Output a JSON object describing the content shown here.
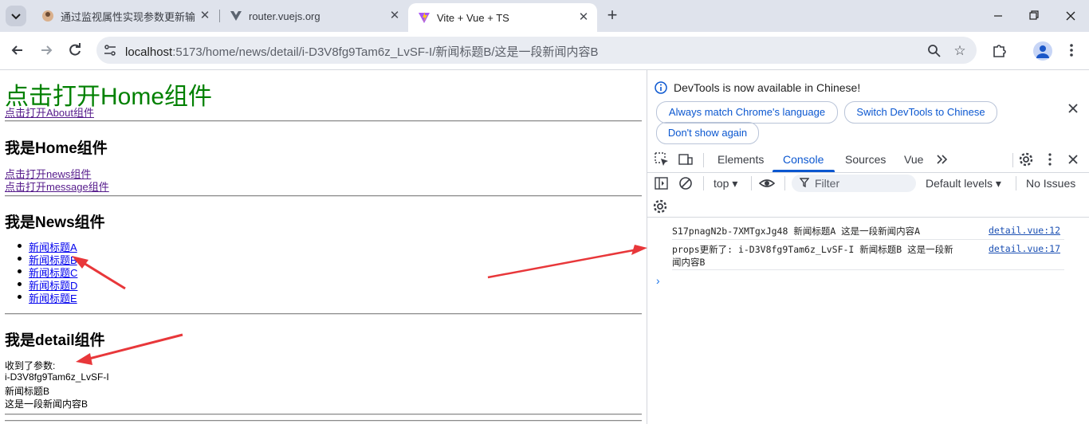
{
  "browser": {
    "tabs": [
      {
        "title": "通过监视属性实现参数更新输出",
        "icon": "vue-avatar-icon"
      },
      {
        "title": "router.vuejs.org",
        "icon": "vue-router-icon"
      },
      {
        "title": "Vite + Vue + TS",
        "icon": "vite-icon",
        "active": true
      }
    ],
    "url_host": "localhost",
    "url_path": ":5173/home/news/detail/i-D3V8fg9Tam6z_LvSF-I/新闻标题B/这是一段新闻内容B"
  },
  "page": {
    "title": "点击打开Home组件",
    "about_link": "点击打开About组件",
    "home_heading": "我是Home组件",
    "news_link": "点击打开news组件",
    "message_link": "点击打开message组件",
    "news_heading": "我是News组件",
    "news_items": [
      "新闻标题A",
      "新闻标题B",
      "新闻标题C",
      "新闻标题D",
      "新闻标题E"
    ],
    "detail_heading": "我是detail组件",
    "received_label": "收到了参数:",
    "param_id": "i-D3V8fg9Tam6z_LvSF-I",
    "param_title": "新闻标题B",
    "param_content": "这是一段新闻内容B"
  },
  "devtools": {
    "info_text": "DevTools is now available in Chinese!",
    "btn_match": "Always match Chrome's language",
    "btn_switch": "Switch DevTools to Chinese",
    "btn_dont_show": "Don't show again",
    "tabs": [
      "Elements",
      "Console",
      "Sources",
      "Vue"
    ],
    "active_tab": "Console",
    "context": "top",
    "filter_placeholder": "Filter",
    "levels": "Default levels",
    "issues": "No Issues",
    "messages": [
      {
        "text": "S17pnagN2b-7XMTgxJg48 新闻标题A 这是一段新闻内容A",
        "source": "detail.vue:12"
      },
      {
        "text_line1": "props更新了: i-D3V8fg9Tam6z_LvSF-I 新闻标题B 这是一段新",
        "text_line2": "闻内容B",
        "source": "detail.vue:17"
      }
    ]
  },
  "colors": {
    "title_green": "#008000",
    "arrow_red": "#e8373a",
    "devtools_blue": "#0b57d0"
  }
}
